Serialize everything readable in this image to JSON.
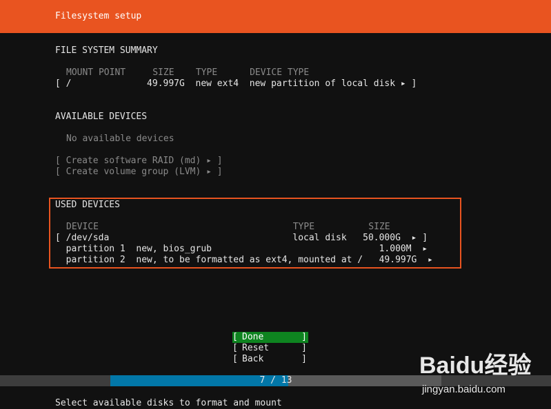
{
  "header": {
    "title": "Filesystem setup"
  },
  "summary": {
    "heading": "FILE SYSTEM SUMMARY",
    "columns": "MOUNT POINT     SIZE    TYPE      DEVICE TYPE",
    "rows": [
      "[ /              49.997G  new ext4  new partition of local disk ▸ ]"
    ]
  },
  "available": {
    "heading": "AVAILABLE DEVICES",
    "empty": "No available devices",
    "raid_action": "[ Create software RAID (md) ▸ ]",
    "lvm_action": "[ Create volume group (LVM) ▸ ]"
  },
  "used": {
    "heading": "USED DEVICES",
    "columns": "DEVICE                                    TYPE          SIZE",
    "rows": [
      "[ /dev/sda                                  local disk   50.000G  ▸ ]",
      "  partition 1  new, bios_grub                               1.000M  ▸",
      "  partition 2  new, to be formatted as ext4, mounted at /   49.997G  ▸"
    ]
  },
  "buttons": {
    "done": "Done",
    "reset": "Reset",
    "back": "Back"
  },
  "progress": {
    "text": "7 / 13",
    "current": 7,
    "total": 13
  },
  "status": "Select available disks to format and mount",
  "watermark": {
    "logo": "Baidu经验",
    "url": "jingyan.baidu.com"
  },
  "colors": {
    "accent": "#e95420",
    "selected": "#0e8420",
    "progress": "#0277a8"
  }
}
